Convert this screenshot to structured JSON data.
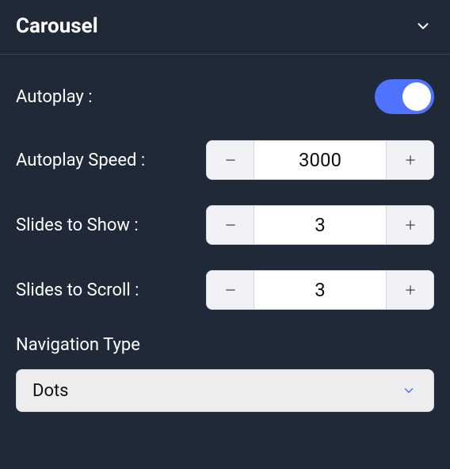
{
  "header": {
    "title": "Carousel"
  },
  "settings": {
    "autoplay": {
      "label": "Autoplay :",
      "on": true
    },
    "autoplay_speed": {
      "label": "Autoplay Speed :",
      "value": "3000"
    },
    "slides_to_show": {
      "label": "Slides to Show :",
      "value": "3"
    },
    "slides_to_scroll": {
      "label": "Slides to Scroll :",
      "value": "3"
    },
    "navigation_type": {
      "label": "Navigation Type",
      "value": "Dots"
    }
  }
}
